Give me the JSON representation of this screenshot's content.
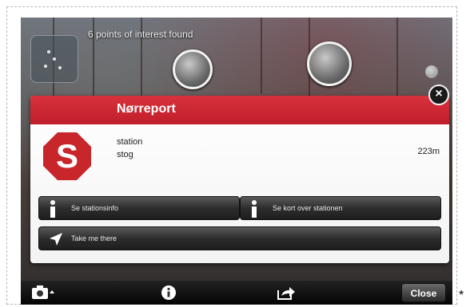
{
  "ar_view": {
    "poi_count_text": "6 points of interest found"
  },
  "detail_card": {
    "title": "Nørreport",
    "logo_letter": "S",
    "type_line1": "station",
    "type_line2": "stog",
    "distance": "223m",
    "buttons": {
      "station_info": "Se stationsinfo",
      "map": "Se kort over stationen",
      "directions": "Take me there"
    }
  },
  "toolbar": {
    "close_label": "Close"
  },
  "colors": {
    "header_red": "#cc2530",
    "logo_red": "#c8262b"
  },
  "icons": [
    "radar-icon",
    "camera-icon",
    "info-icon",
    "share-icon",
    "close-circle-icon",
    "navigation-arrow-icon",
    "info-i-icon"
  ]
}
